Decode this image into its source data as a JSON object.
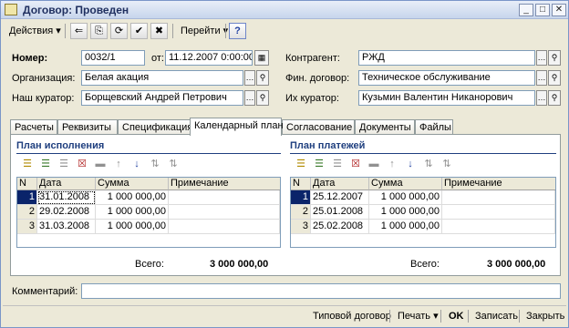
{
  "window": {
    "title": "Договор: Проведен"
  },
  "toolbar": {
    "actions_label": "Действия",
    "goto_label": "Перейти",
    "help_label": "?"
  },
  "header": {
    "number_label": "Номер:",
    "number_value": "0032/1",
    "date_label": "от:",
    "date_value": "11.12.2007  0:00:00",
    "org_label": "Организация:",
    "org_value": "Белая акация",
    "curator_label": "Наш куратор:",
    "curator_value": "Борщевский Андрей Петрович",
    "counterparty_label": "Контрагент:",
    "counterparty_value": "РЖД",
    "fin_label": "Фин. договор:",
    "fin_value": "Техническое обслуживание",
    "their_label": "Их куратор:",
    "their_value": "Кузьмин Валентин Никанорович"
  },
  "tabs": [
    {
      "label": "Расчеты"
    },
    {
      "label": "Реквизиты"
    },
    {
      "label": "Спецификация"
    },
    {
      "label": "Календарный план"
    },
    {
      "label": "Согласование"
    },
    {
      "label": "Документы"
    },
    {
      "label": "Файлы"
    }
  ],
  "plan": {
    "title": "План исполнения",
    "columns": [
      "N",
      "Дата",
      "Сумма",
      "Примечание"
    ],
    "rows": [
      {
        "n": "1",
        "date": "31.01.2008",
        "sum": "1 000 000,00",
        "note": ""
      },
      {
        "n": "2",
        "date": "29.02.2008",
        "sum": "1 000 000,00",
        "note": ""
      },
      {
        "n": "3",
        "date": "31.03.2008",
        "sum": "1 000 000,00",
        "note": ""
      }
    ],
    "total_label": "Всего:",
    "total_value": "3 000 000,00"
  },
  "payments": {
    "title": "План платежей",
    "columns": [
      "N",
      "Дата",
      "Сумма",
      "Примечание"
    ],
    "rows": [
      {
        "n": "1",
        "date": "25.12.2007",
        "sum": "1 000 000,00",
        "note": ""
      },
      {
        "n": "2",
        "date": "25.01.2008",
        "sum": "1 000 000,00",
        "note": ""
      },
      {
        "n": "3",
        "date": "25.02.2008",
        "sum": "1 000 000,00",
        "note": ""
      }
    ],
    "total_label": "Всего:",
    "total_value": "3 000 000,00"
  },
  "comment": {
    "label": "Комментарий:",
    "value": ""
  },
  "footer": {
    "typical_label": "Типовой договор",
    "print_label": "Печать",
    "ok_label": "OK",
    "save_label": "Записать",
    "close_label": "Закрыть"
  },
  "colors": {
    "selection": "#0a246a",
    "section_title": "#1f3f7f",
    "window_bg": "#ece9d8"
  }
}
